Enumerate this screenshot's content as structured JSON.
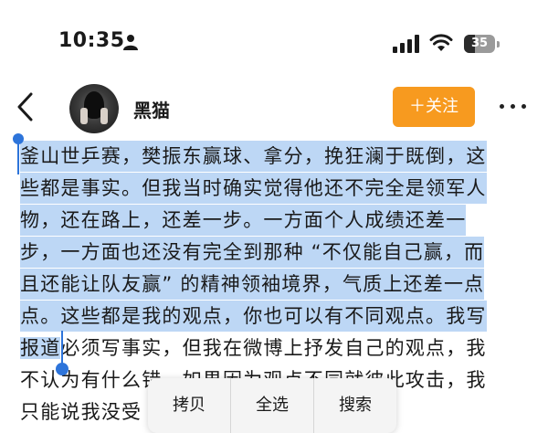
{
  "status_bar": {
    "time": "10:35",
    "battery_level": "35",
    "icons": [
      "person-icon",
      "signal-icon",
      "wifi-icon",
      "battery-icon"
    ]
  },
  "nav": {
    "username": "黑猫",
    "follow_label": "＋关注",
    "icons": [
      "back-icon",
      "more-icon"
    ],
    "follow_color": "#f79a1f"
  },
  "article": {
    "lines": [
      "釜山世乒赛，樊振东赢球、拿分，挽狂澜于既倒，这",
      "些都是事实。但我当时确实觉得他还不完全是领军人",
      "物，还在路上，还差一步。一方面个人成绩还差一",
      "步，一方面也还没有完全到那种 “不仅能自己赢，而",
      "且还能让队友赢” 的精神领袖境界，气质上还差一点",
      "点。这些都是我的观点，你也可以有不同观点。我写",
      "报道",
      "必须写事实，但我在微博上抒发自己的观点，我",
      "不认为有什么错。如果因为观点不同就彼此攻击，我",
      "只能说我没受"
    ],
    "selection_color": "#bdd7f5",
    "handle_color": "#2d74da"
  },
  "context_menu": {
    "items": [
      "拷贝",
      "全选",
      "搜索"
    ]
  }
}
